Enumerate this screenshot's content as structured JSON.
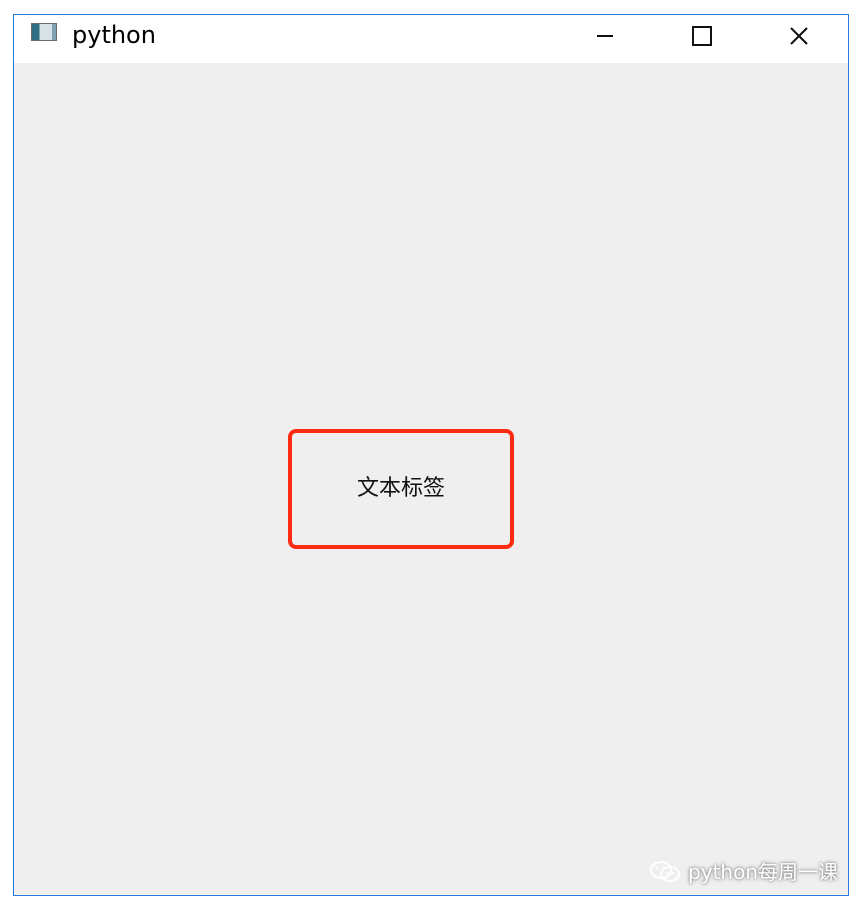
{
  "window": {
    "title": "python",
    "icon": "app-window-icon",
    "controls": {
      "minimize": "minimize-icon",
      "maximize": "maximize-icon",
      "close": "close-icon"
    }
  },
  "content": {
    "label_text": "文本标签",
    "highlight_color": "#ff2a12"
  },
  "watermark": {
    "text": "python每周一课",
    "icon": "wechat-icon"
  }
}
